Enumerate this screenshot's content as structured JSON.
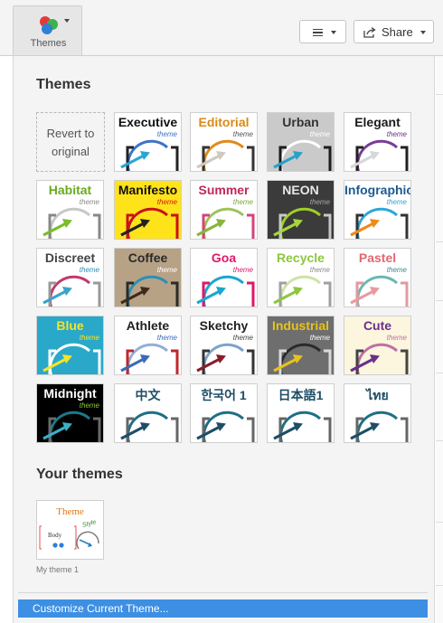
{
  "toolbar": {
    "themes_label": "Themes",
    "share_label": "Share"
  },
  "panel": {
    "themes_heading": "Themes",
    "revert": [
      "Revert to",
      "original"
    ],
    "your_themes_heading": "Your themes",
    "customize_label": "Customize Current Theme..."
  },
  "themes": [
    {
      "name": "Executive",
      "sub": "theme",
      "bg": "#ffffff",
      "fg": "#111111",
      "subColor": "#3b74c6",
      "arc": "#3b74c6",
      "arrow": "#27a6d3",
      "bracket": "#222222"
    },
    {
      "name": "Editorial",
      "sub": "theme",
      "bg": "#ffffff",
      "fg": "#d98a16",
      "subColor": "#555555",
      "arc": "#e08a1a",
      "arrow": "#cfc9c0",
      "bracket": "#333333"
    },
    {
      "name": "Urban",
      "sub": "theme",
      "bg": "#cacaca",
      "fg": "#333333",
      "subColor": "#ffffff",
      "arc": "#ffffff",
      "arrow": "#2aa0c8",
      "bracket": "#1c1c1c"
    },
    {
      "name": "Elegant",
      "sub": "theme",
      "bg": "#ffffff",
      "fg": "#1a1a1a",
      "subColor": "#6b2f8c",
      "arc": "#7a3b96",
      "arrow": "#d7d7d7",
      "bracket": "#222222"
    },
    {
      "name": "Habitat",
      "sub": "theme",
      "bg": "#ffffff",
      "fg": "#6aaa1e",
      "subColor": "#888888",
      "arc": "#c7c7c7",
      "arrow": "#7bbd2a",
      "bracket": "#888888"
    },
    {
      "name": "Manifesto",
      "sub": "theme",
      "bg": "#ffe31a",
      "fg": "#111111",
      "subColor": "#d8131a",
      "arc": "#c9121a",
      "arrow": "#222222",
      "bracket": "#c9121a"
    },
    {
      "name": "Summer",
      "sub": "theme",
      "bg": "#ffffff",
      "fg": "#c0265a",
      "subColor": "#7aa63a",
      "arc": "#9dc35a",
      "arrow": "#88b53c",
      "bracket": "#d4447a"
    },
    {
      "name": "NEON",
      "sub": "theme",
      "bg": "#3b3b3b",
      "fg": "#e8e8e8",
      "subColor": "#a6a6a6",
      "arc": "#9fd02a",
      "arrow": "#a6d63c",
      "bracket": "#c8c8c8"
    },
    {
      "name": "Infographic",
      "sub": "theme",
      "bg": "#ffffff",
      "fg": "#1c5a93",
      "subColor": "#2ea6d8",
      "arc": "#2ea6d8",
      "arrow": "#f08a17",
      "bracket": "#333333"
    },
    {
      "name": "Discreet",
      "sub": "theme",
      "bg": "#ffffff",
      "fg": "#444444",
      "subColor": "#2f8fb5",
      "arc": "#c0396a",
      "arrow": "#3aa3c9",
      "bracket": "#999999"
    },
    {
      "name": "Coffee",
      "sub": "theme",
      "bg": "#b7a286",
      "fg": "#2a2a2a",
      "subColor": "#ffffff",
      "arc": "#2a90b4",
      "arrow": "#3d2a1a",
      "bracket": "#2a2a2a"
    },
    {
      "name": "Goa",
      "sub": "theme",
      "bg": "#ffffff",
      "fg": "#e0176a",
      "subColor": "#e0176a",
      "arc": "#1aa6cf",
      "arrow": "#1aa6cf",
      "bracket": "#e0176a"
    },
    {
      "name": "Recycle",
      "sub": "theme",
      "bg": "#ffffff",
      "fg": "#8ec63f",
      "subColor": "#8a8a8a",
      "arc": "#cfe2a8",
      "arrow": "#8ec63f",
      "bracket": "#a0a0a0"
    },
    {
      "name": "Pastel",
      "sub": "theme",
      "bg": "#ffffff",
      "fg": "#e0686f",
      "subColor": "#3a8a8a",
      "arc": "#6ab7b2",
      "arrow": "#e99aa0",
      "bracket": "#e09aa0"
    },
    {
      "name": "Blue",
      "sub": "theme",
      "bg": "#2aa8c9",
      "fg": "#f4e32a",
      "subColor": "#f4e32a",
      "arc": "#ffffff",
      "arrow": "#f4e32a",
      "bracket": "#ffffff"
    },
    {
      "name": "Athlete",
      "sub": "theme",
      "bg": "#ffffff",
      "fg": "#222222",
      "subColor": "#3b6ab8",
      "arc": "#8fb0d8",
      "arrow": "#3b6ab8",
      "bracket": "#c0262b"
    },
    {
      "name": "Sketchy",
      "sub": "theme",
      "bg": "#ffffff",
      "fg": "#222222",
      "subColor": "#444444",
      "arc": "#7da3c8",
      "arrow": "#8b1d2a",
      "bracket": "#333333"
    },
    {
      "name": "Industrial",
      "sub": "theme",
      "bg": "#6e6e6e",
      "fg": "#e7c21e",
      "subColor": "#ffffff",
      "arc": "#2a2a2a",
      "arrow": "#e7c21e",
      "bracket": "#d9d9d9"
    },
    {
      "name": "Cute",
      "sub": "theme",
      "bg": "#fbf6dd",
      "fg": "#6b2f8c",
      "subColor": "#c06fa6",
      "arc": "#c06fa6",
      "arrow": "#6b2f8c",
      "bracket": "#444444"
    },
    {
      "name": "Midnight",
      "sub": "theme",
      "bg": "#000000",
      "fg": "#ffffff",
      "subColor": "#8ec63f",
      "arc": "#1a7a8a",
      "arrow": "#3ab0c8",
      "bracket": "#6a6a6a"
    },
    {
      "name": "中文",
      "sub": "",
      "bg": "#ffffff",
      "fg": "#1d4e66",
      "subColor": "#1d4e66",
      "arc": "#1d6f86",
      "arrow": "#1d4e66",
      "bracket": "#666666"
    },
    {
      "name": "한국어 1",
      "sub": "",
      "bg": "#ffffff",
      "fg": "#1d4e66",
      "subColor": "#1d4e66",
      "arc": "#1d6f86",
      "arrow": "#1d4e66",
      "bracket": "#666666"
    },
    {
      "name": "日本語1",
      "sub": "",
      "bg": "#ffffff",
      "fg": "#1d4e66",
      "subColor": "#1d4e66",
      "arc": "#1d6f86",
      "arrow": "#1d4e66",
      "bracket": "#666666"
    },
    {
      "name": "ไทย",
      "sub": "",
      "bg": "#ffffff",
      "fg": "#1d4e66",
      "subColor": "#1d4e66",
      "arc": "#1d6f86",
      "arrow": "#1d4e66",
      "bracket": "#666666"
    }
  ],
  "your_themes": [
    {
      "title": "Theme",
      "body": "Body",
      "style": "Style",
      "label": "My theme 1"
    }
  ],
  "colors": {
    "accent": "#3d8fe3",
    "panel_bg": "#f4f4f4",
    "logo": [
      "#e33b3b",
      "#3db24a",
      "#2f7fd6"
    ]
  },
  "icons": [
    "themes-logo-icon",
    "dropdown-caret-icon",
    "menu-lines-icon",
    "share-icon"
  ]
}
